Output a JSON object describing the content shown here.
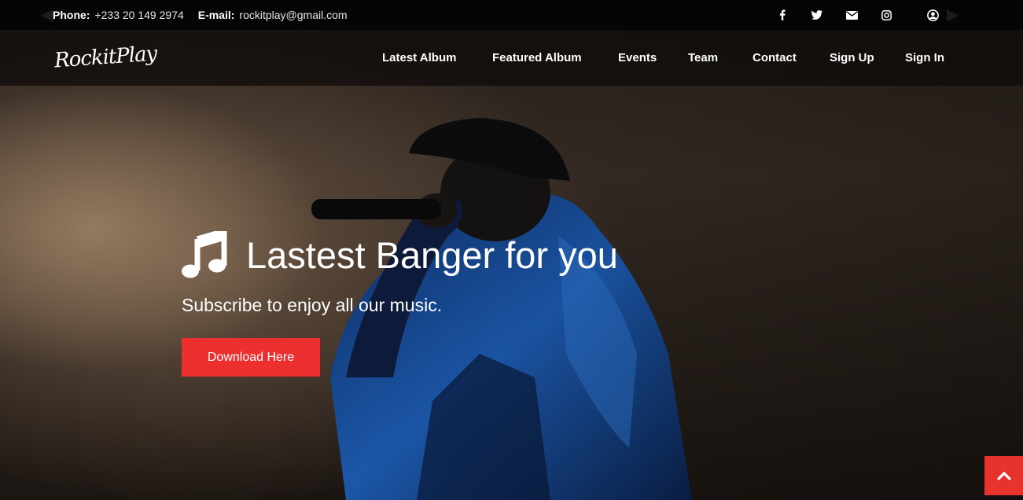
{
  "topbar": {
    "phone_label": "Phone:",
    "phone_value": "+233 20 149 2974",
    "email_label": "E-mail:",
    "email_value": "rockitplay@gmail.com",
    "social_icons": [
      "facebook-icon",
      "twitter-icon",
      "envelope-icon",
      "instagram-icon",
      "user-circle-icon"
    ]
  },
  "nav": {
    "logo": "RockitPlay",
    "items": [
      "Latest Album",
      "Featured Album",
      "Events",
      "Team",
      "Contact",
      "Sign Up",
      "Sign In"
    ]
  },
  "hero": {
    "icon": "music-note-icon",
    "title": "Lastest Banger for you",
    "subtitle": "Subscribe to enjoy all our music.",
    "button": "Download Here"
  },
  "scroll_top_icon": "chevron-up-icon",
  "colors": {
    "accent": "#ee2f2f",
    "topbar_bg": "#050505",
    "nav_bg": "#0f0c0a",
    "text": "#ffffff"
  }
}
